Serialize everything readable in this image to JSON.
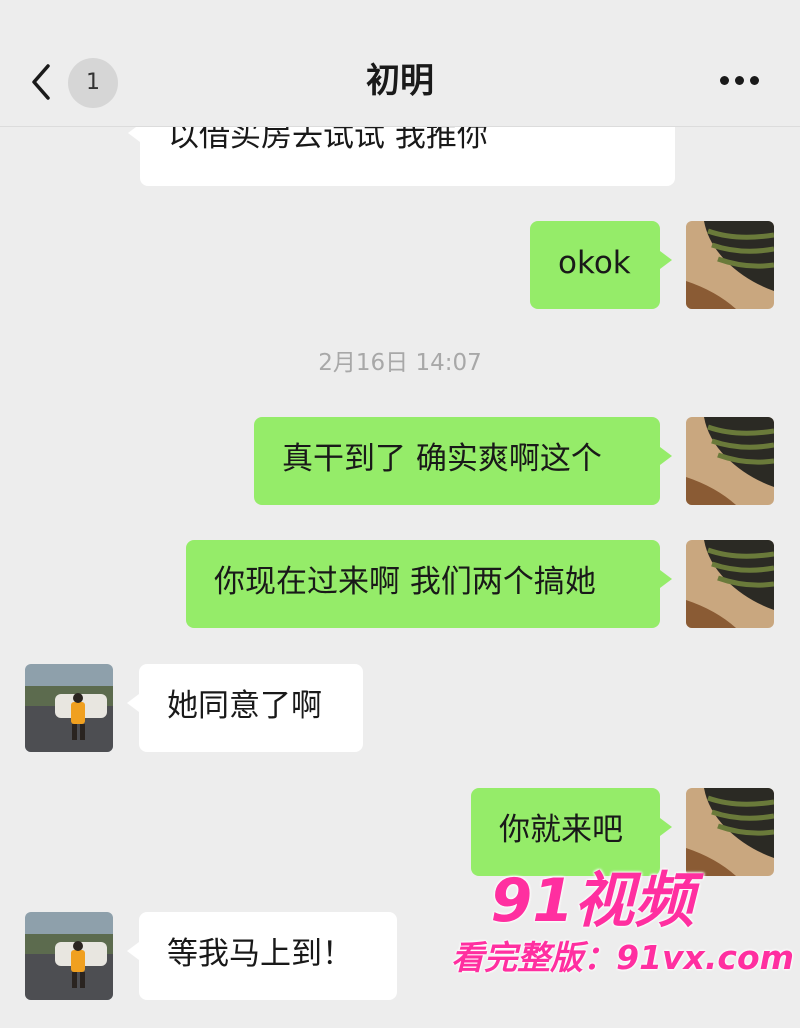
{
  "header": {
    "unread_count": "1",
    "title": "初明"
  },
  "messages": [
    {
      "side": "in",
      "text": "以借买房去试试 我推你"
    },
    {
      "side": "out",
      "text": "okok"
    },
    {
      "side": "time",
      "text": "2月16日 14:07"
    },
    {
      "side": "out",
      "text": "真干到了 确实爽啊这个"
    },
    {
      "side": "out",
      "text": "你现在过来啊 我们两个搞她"
    },
    {
      "side": "in",
      "text": "她同意了啊"
    },
    {
      "side": "out",
      "text": "你就来吧"
    },
    {
      "side": "in",
      "text": "等我马上到！"
    }
  ],
  "watermark": {
    "logo": "91视频",
    "url": "看完整版：91vx.com"
  },
  "colors": {
    "outgoing_bubble": "#95ec69",
    "incoming_bubble": "#ffffff",
    "background": "#ededed",
    "watermark": "#ff2fa0"
  }
}
